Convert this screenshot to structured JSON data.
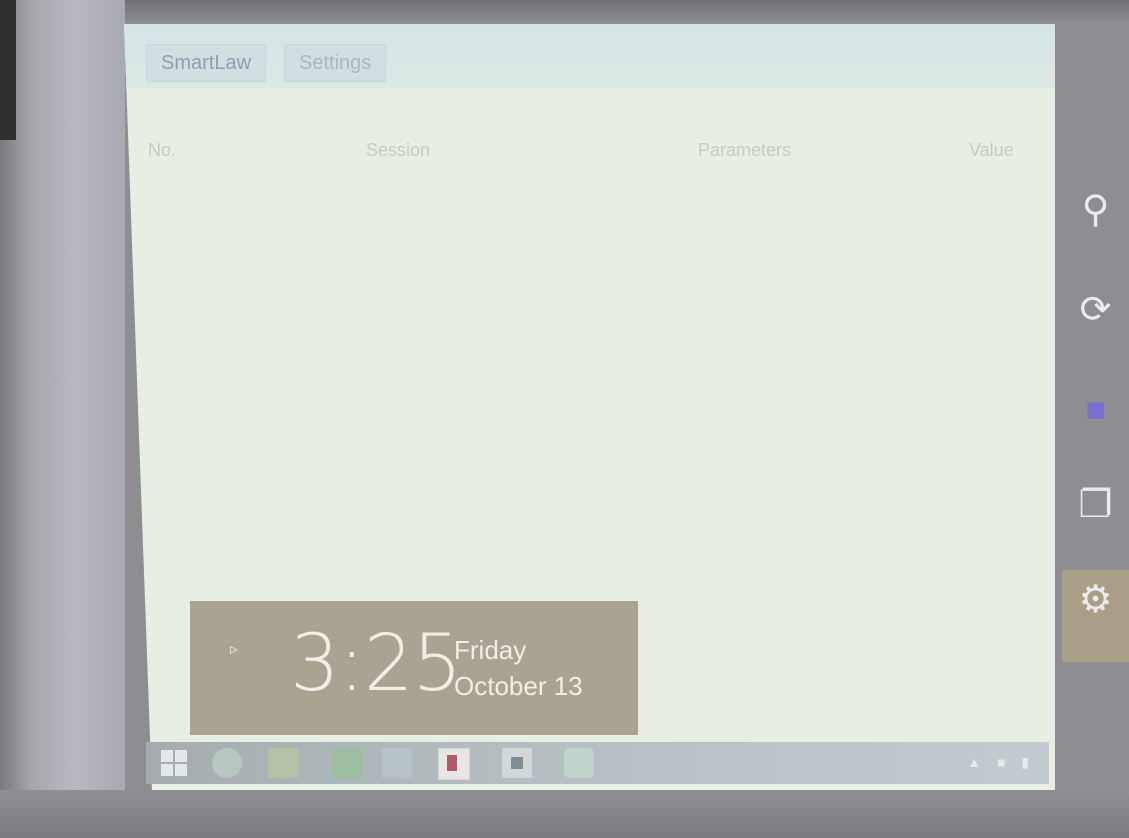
{
  "tabs": [
    "SmartLaw",
    "Settings"
  ],
  "list": {
    "columns": [
      "No.",
      "Session",
      "Parameters",
      "Value"
    ]
  },
  "clock": {
    "time": "3:25",
    "day": "Friday",
    "date": "October 13"
  },
  "taskbar": {
    "items": [
      "start",
      "internet-explorer",
      "file-explorer",
      "store",
      "app",
      "app",
      "app",
      "app"
    ]
  },
  "charms": [
    "search",
    "share",
    "start",
    "devices",
    "settings"
  ],
  "colors": {
    "screen": "#e6efe2",
    "clock_panel": "#aaa393",
    "charm_start": "#7a6fd0",
    "charm_settings_active": "#a99f86"
  }
}
